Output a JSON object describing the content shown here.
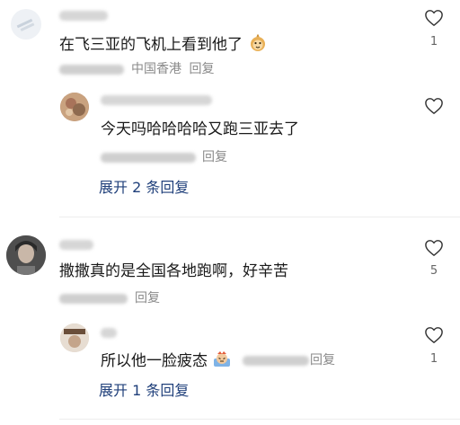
{
  "comments": [
    {
      "text": "在飞三亚的飞机上看到他了",
      "location": "中国香港",
      "reply_label": "回复",
      "likes": "1",
      "emoji": "monkey-face",
      "replies": [
        {
          "text": "今天吗哈哈哈哈又跑三亚去了",
          "reply_label": "回复"
        }
      ],
      "expand_label": "展开 2 条回复"
    },
    {
      "text": "撒撒真的是全国各地跑啊，好辛苦",
      "reply_label": "回复",
      "likes": "5",
      "replies": [
        {
          "text": "所以他一脸疲态",
          "reply_label": "回复",
          "likes": "1",
          "emoji": "tired-face"
        }
      ],
      "expand_label": "展开 1 条回复"
    }
  ],
  "colors": {
    "accent_link": "#1f3f7a",
    "meta_gray": "#8a8a8a"
  },
  "icons": {
    "like": "heart-outline-icon"
  }
}
